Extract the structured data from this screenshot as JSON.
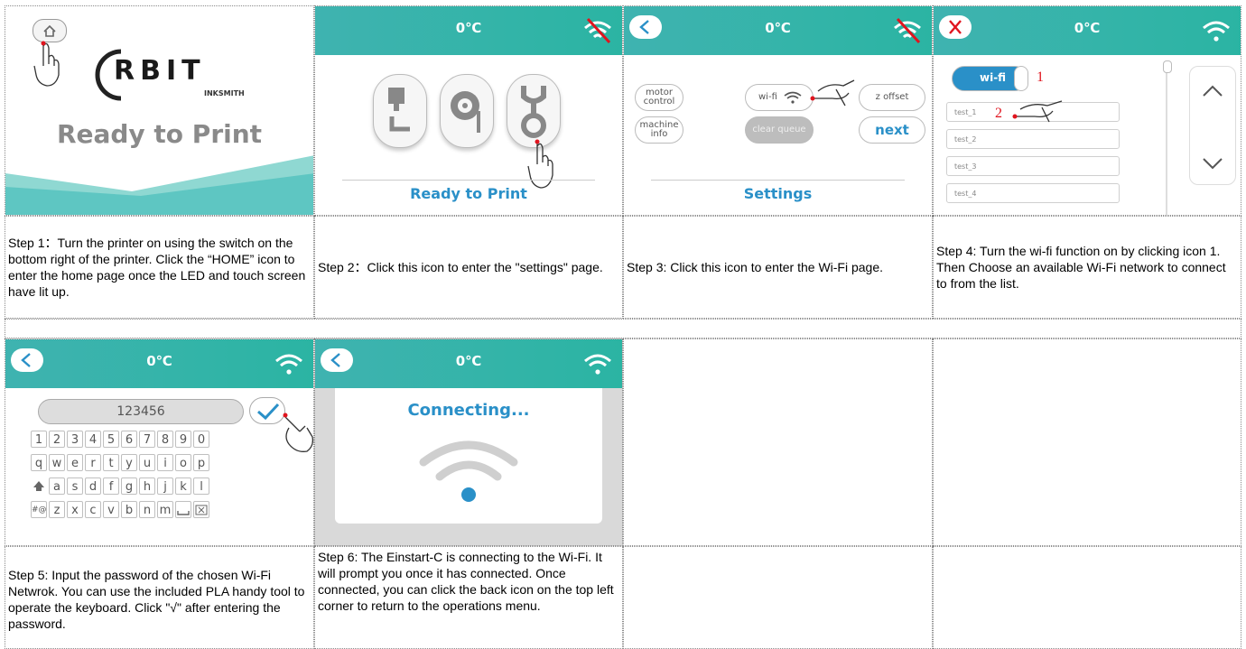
{
  "temp": "0℃",
  "screens": {
    "s1": {
      "brand": "RBIT",
      "sub": "INKSMITH",
      "status": "Ready to Print"
    },
    "s2": {
      "status": "Ready to Print"
    },
    "s3": {
      "motor": "motor control",
      "machine": "machine info",
      "wifi": "wi-fi",
      "clear": "clear queue",
      "zoffset": "z offset",
      "next": "next",
      "title": "Settings"
    },
    "s4": {
      "toggle": "wi-fi",
      "n1": "1",
      "n2": "2",
      "networks": [
        "test_1",
        "test_2",
        "test_3",
        "test_4"
      ]
    },
    "s5": {
      "password": "123456",
      "rows": [
        [
          "1",
          "2",
          "3",
          "4",
          "5",
          "6",
          "7",
          "8",
          "9",
          "0"
        ],
        [
          "q",
          "w",
          "e",
          "r",
          "t",
          "y",
          "u",
          "i",
          "o",
          "p"
        ],
        [
          "a",
          "s",
          "d",
          "f",
          "g",
          "h",
          "j",
          "k",
          "l"
        ],
        [
          "z",
          "x",
          "c",
          "v",
          "b",
          "n",
          "m"
        ]
      ],
      "sym": "#@"
    },
    "s6": {
      "status": "Connecting..."
    }
  },
  "captions": {
    "c1": "Step 1：Turn the printer on using the switch on the bottom right of the printer. Click the “HOME” icon to enter the home page once the LED and touch screen have lit up.",
    "c2": "Step 2：Click this icon to enter the \"settings\" page.",
    "c3": "Step 3: Click this icon to enter the Wi-Fi page.",
    "c4": "Step 4: Turn the wi-fi function on by clicking icon 1. Then Choose an available Wi-Fi network to connect to from the list.",
    "c5": "Step 5: Input the password of the chosen Wi-Fi Netwrok. You can use the included PLA handy tool to operate the keyboard. Click \"√\" after entering the password.",
    "c6": "Step 6: The Einstart-C is connecting to the Wi-Fi. It will prompt you once it has connected. Once connected, you can click the back icon on the top left corner to return to the operations menu."
  },
  "colors": {
    "teal": "#3fb3b0",
    "blue": "#2a90c8",
    "red": "#e0141e"
  }
}
